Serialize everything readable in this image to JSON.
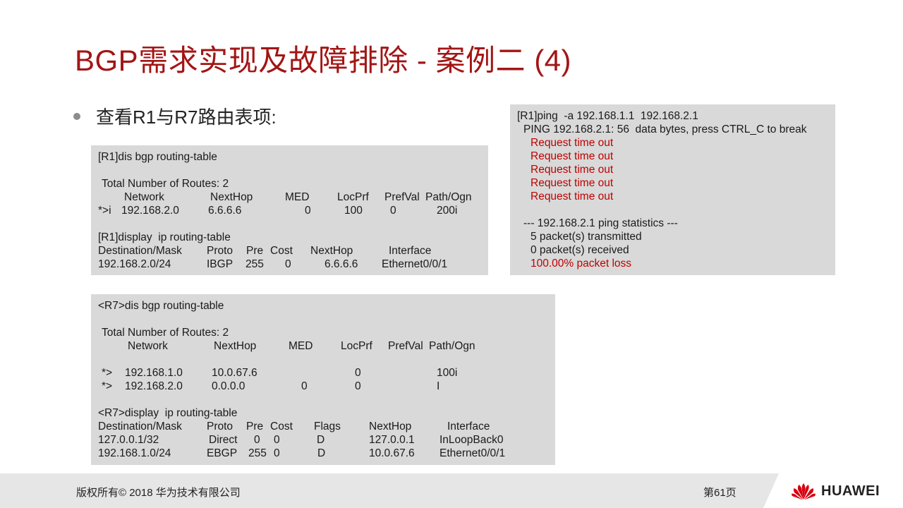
{
  "title": "BGP需求实现及故障排除 - 案例二 (4)",
  "bullet": "查看R1与R7路由表项:",
  "r1_box": {
    "cmd1": "[R1]dis bgp routing-table",
    "total": "Total Number of Routes: 2",
    "bgp_header": [
      "Network",
      "NextHop",
      "MED",
      "LocPrf",
      "PrefVal",
      "Path/Ogn"
    ],
    "bgp_row": [
      "*>i",
      "192.168.2.0",
      "6.6.6.6",
      "0",
      "100",
      "0",
      "200i"
    ],
    "cmd2": "[R1]display  ip routing-table",
    "ip_header": [
      "Destination/Mask",
      "Proto",
      "Pre",
      "Cost",
      "NextHop",
      "Interface"
    ],
    "ip_row": [
      "192.168.2.0/24",
      "IBGP",
      "255",
      "0",
      "6.6.6.6",
      "Ethernet0/0/1"
    ]
  },
  "r7_box": {
    "cmd1": "<R7>dis bgp routing-table",
    "total": "Total Number of Routes: 2",
    "bgp_header": [
      "Network",
      "NextHop",
      "MED",
      "LocPrf",
      "PrefVal",
      "Path/Ogn"
    ],
    "bgp_rows": [
      [
        "*>",
        "192.168.1.0",
        "10.0.67.6",
        "",
        "0",
        "100i"
      ],
      [
        "*>",
        "192.168.2.0",
        "0.0.0.0",
        "0",
        "0",
        "I"
      ]
    ],
    "cmd2": "<R7>display  ip routing-table",
    "ip_header": [
      "Destination/Mask",
      "Proto",
      "Pre",
      "Cost",
      "Flags",
      "NextHop",
      "Interface"
    ],
    "ip_rows": [
      [
        "127.0.0.1/32",
        "Direct",
        "0",
        "0",
        "D",
        "127.0.0.1",
        "InLoopBack0"
      ],
      [
        "192.168.1.0/24",
        "EBGP",
        "255",
        "0",
        "D",
        "10.0.67.6",
        "Ethernet0/0/1"
      ]
    ]
  },
  "ping_box": {
    "cmd": "[R1]ping  -a 192.168.1.1  192.168.2.1",
    "ping_line": "PING 192.168.2.1: 56  data bytes, press CTRL_C to break",
    "timeouts": [
      "Request time out",
      "Request time out",
      "Request time out",
      "Request time out",
      "Request time out"
    ],
    "stats_title": "--- 192.168.2.1 ping statistics ---",
    "transmitted": "5 packet(s) transmitted",
    "received": "0 packet(s) received",
    "loss": "100.00% packet loss"
  },
  "footer": {
    "copyright": "版权所有© 2018 华为技术有限公司",
    "page": "第61页",
    "logo_text": "HUAWEI"
  },
  "colors": {
    "title": "#a31515",
    "alert_text": "#c00000",
    "box_bg": "#d9d9d9",
    "footer_bg": "#e6e6e6"
  }
}
